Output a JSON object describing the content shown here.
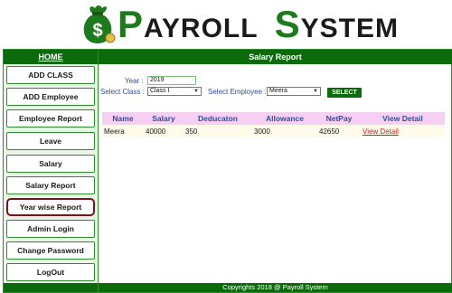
{
  "header": {
    "brand_p": "P",
    "brand_ayroll": "AYROLL",
    "brand_s": "S",
    "brand_ystem": "YSTEM",
    "logo_icon": "money-bag-icon"
  },
  "sidebar": {
    "home": "HOME",
    "items": [
      {
        "label": "ADD CLASS"
      },
      {
        "label": "ADD Employee"
      },
      {
        "label": "Employee Report"
      },
      {
        "label": "Leave"
      },
      {
        "label": "Salary"
      },
      {
        "label": "Salary Report"
      },
      {
        "label": "Year wise Report"
      },
      {
        "label": "Admin Login"
      },
      {
        "label": "Change Password"
      },
      {
        "label": "LogOut"
      }
    ]
  },
  "main": {
    "title": "Salary Report",
    "year_label": "Year :",
    "year_value": "2019",
    "class_label": "Select Class :",
    "class_value": "Class I",
    "employee_label": "Select Employee :",
    "employee_value": "Meera",
    "select_button": "SELECT",
    "table": {
      "headers": [
        "Name",
        "Salary",
        "Deducaton",
        "Allowance",
        "NetPay",
        "View Detail"
      ],
      "rows": [
        [
          "Meera",
          "40000",
          "350",
          "3000",
          "42650",
          "View Detail"
        ]
      ]
    }
  },
  "footer": {
    "text": "Copyrights 2018 @ Payroll System"
  },
  "colors": {
    "primary_green": "#0b6b0b",
    "brand_green": "#1d7a1d",
    "table_header_bg": "#f7cff2",
    "link_red": "#d81b1b",
    "active_border": "#7a1020"
  }
}
